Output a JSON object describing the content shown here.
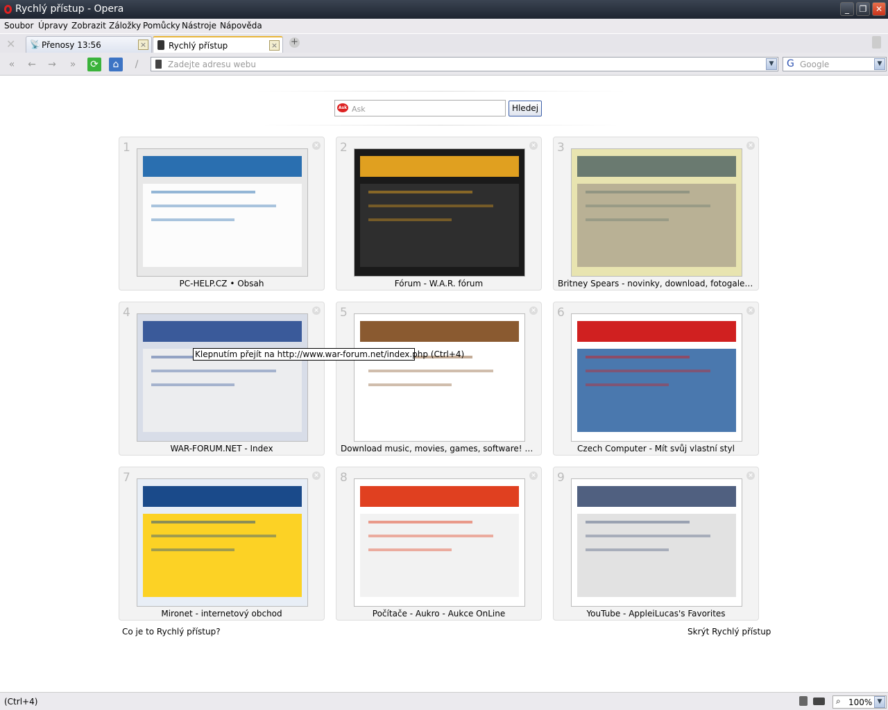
{
  "window": {
    "title": "Rychlý přístup - Opera",
    "minimize": "_",
    "restore": "❐",
    "close": "✕"
  },
  "menu": [
    "Soubor",
    "Úpravy",
    "Zobrazit",
    "Záložky",
    "Pomůcky",
    "Nástroje",
    "Nápověda"
  ],
  "tabs": [
    {
      "label": "Přenosy 13:56",
      "icon": "transfers-icon",
      "active": false
    },
    {
      "label": "Rychlý přístup",
      "icon": "speed-dial-icon",
      "active": true
    }
  ],
  "nav": {
    "address_placeholder": "Zadejte adresu webu",
    "search_placeholder": "Google"
  },
  "speeddial": {
    "search_placeholder": "Ask",
    "search_button": "Hledej",
    "tiles": [
      {
        "num": "1",
        "caption": "PC-HELP.CZ • Obsah",
        "colors": [
          "#e8e8e8",
          "#2a6fb0",
          "#ffffff"
        ]
      },
      {
        "num": "2",
        "caption": "Fórum - W.A.R. fórum",
        "colors": [
          "#1a1a1a",
          "#e0a020",
          "#333333"
        ]
      },
      {
        "num": "3",
        "caption": "Britney Spears - novinky, download, fotogalerie...",
        "colors": [
          "#e8e4b0",
          "#6a7a70",
          "#b0a890"
        ]
      },
      {
        "num": "4",
        "caption": "WAR-FORUM.NET - Index",
        "colors": [
          "#d8dde8",
          "#3a5a9a",
          "#f0f0f0"
        ]
      },
      {
        "num": "5",
        "caption": "Download music, movies, games, software! The ...",
        "colors": [
          "#ffffff",
          "#8a5a30",
          "#ffffff"
        ]
      },
      {
        "num": "6",
        "caption": "Czech Computer - Mít svůj vlastní styl",
        "colors": [
          "#ffffff",
          "#d02020",
          "#2a60a0"
        ]
      },
      {
        "num": "7",
        "caption": "Mironet - internetový obchod",
        "colors": [
          "#e8eef6",
          "#1a4a8a",
          "#ffcc00"
        ]
      },
      {
        "num": "8",
        "caption": "Počítače - Aukro - Aukce OnLine",
        "colors": [
          "#ffffff",
          "#e04020",
          "#f0f0f0"
        ]
      },
      {
        "num": "9",
        "caption": "YouTube - AppleiLucas's Favorites",
        "colors": [
          "#ffffff",
          "#506080",
          "#dddddd"
        ]
      }
    ],
    "help_link": "Co je to Rychlý přístup?",
    "hide_link": "Skrýt Rychlý přístup"
  },
  "tooltip": "Klepnutím přejít na http://www.war-forum.net/index.php (Ctrl+4)",
  "status": {
    "text": "(Ctrl+4)",
    "zoom": "100%"
  }
}
